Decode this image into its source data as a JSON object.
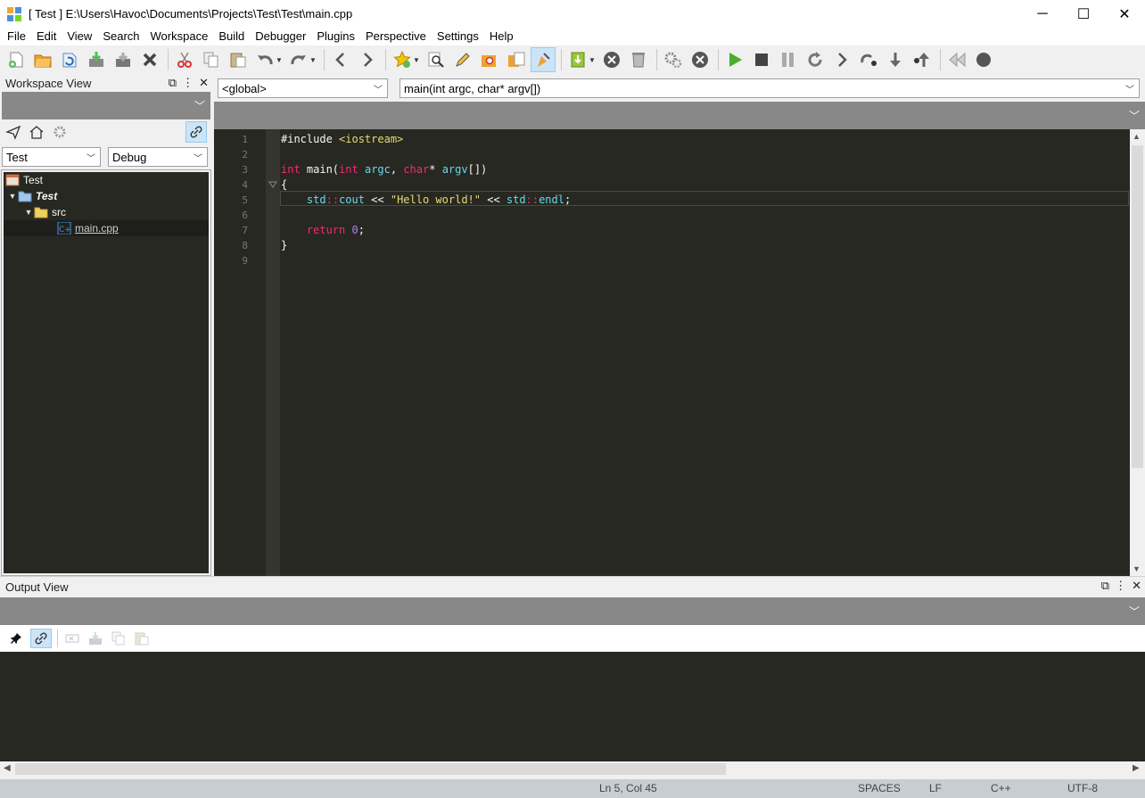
{
  "window": {
    "title": "[ Test ] E:\\Users\\Havoc\\Documents\\Projects\\Test\\Test\\main.cpp",
    "min_glyph": "─",
    "max_glyph": "☐",
    "close_glyph": "✕"
  },
  "menu": [
    "File",
    "Edit",
    "View",
    "Search",
    "Workspace",
    "Build",
    "Debugger",
    "Plugins",
    "Perspective",
    "Settings",
    "Help"
  ],
  "workspace": {
    "title": "Workspace View",
    "project_select": "Test",
    "config_select": "Debug",
    "tree": [
      {
        "label": "Test",
        "kind": "workspace",
        "depth": 0
      },
      {
        "label": "Test",
        "kind": "project",
        "depth": 1
      },
      {
        "label": "src",
        "kind": "folder",
        "depth": 2
      },
      {
        "label": "main.cpp",
        "kind": "file",
        "depth": 3
      }
    ]
  },
  "editor": {
    "scope_combo": "<global>",
    "function_combo": "main(int argc, char* argv[])",
    "line_numbers": [
      "1",
      "2",
      "3",
      "4",
      "5",
      "6",
      "7",
      "8",
      "9"
    ]
  },
  "output": {
    "title": "Output View"
  },
  "status": {
    "position": "Ln 5, Col 45",
    "indent": "SPACES",
    "eol": "LF",
    "language": "C++",
    "encoding": "UTF-8"
  },
  "colors": {
    "editor_bg": "#272822",
    "keyword": "#f92672",
    "type": "#66d9ef",
    "string": "#e6db74",
    "number": "#ae81ff",
    "panel_gray": "#888888"
  }
}
